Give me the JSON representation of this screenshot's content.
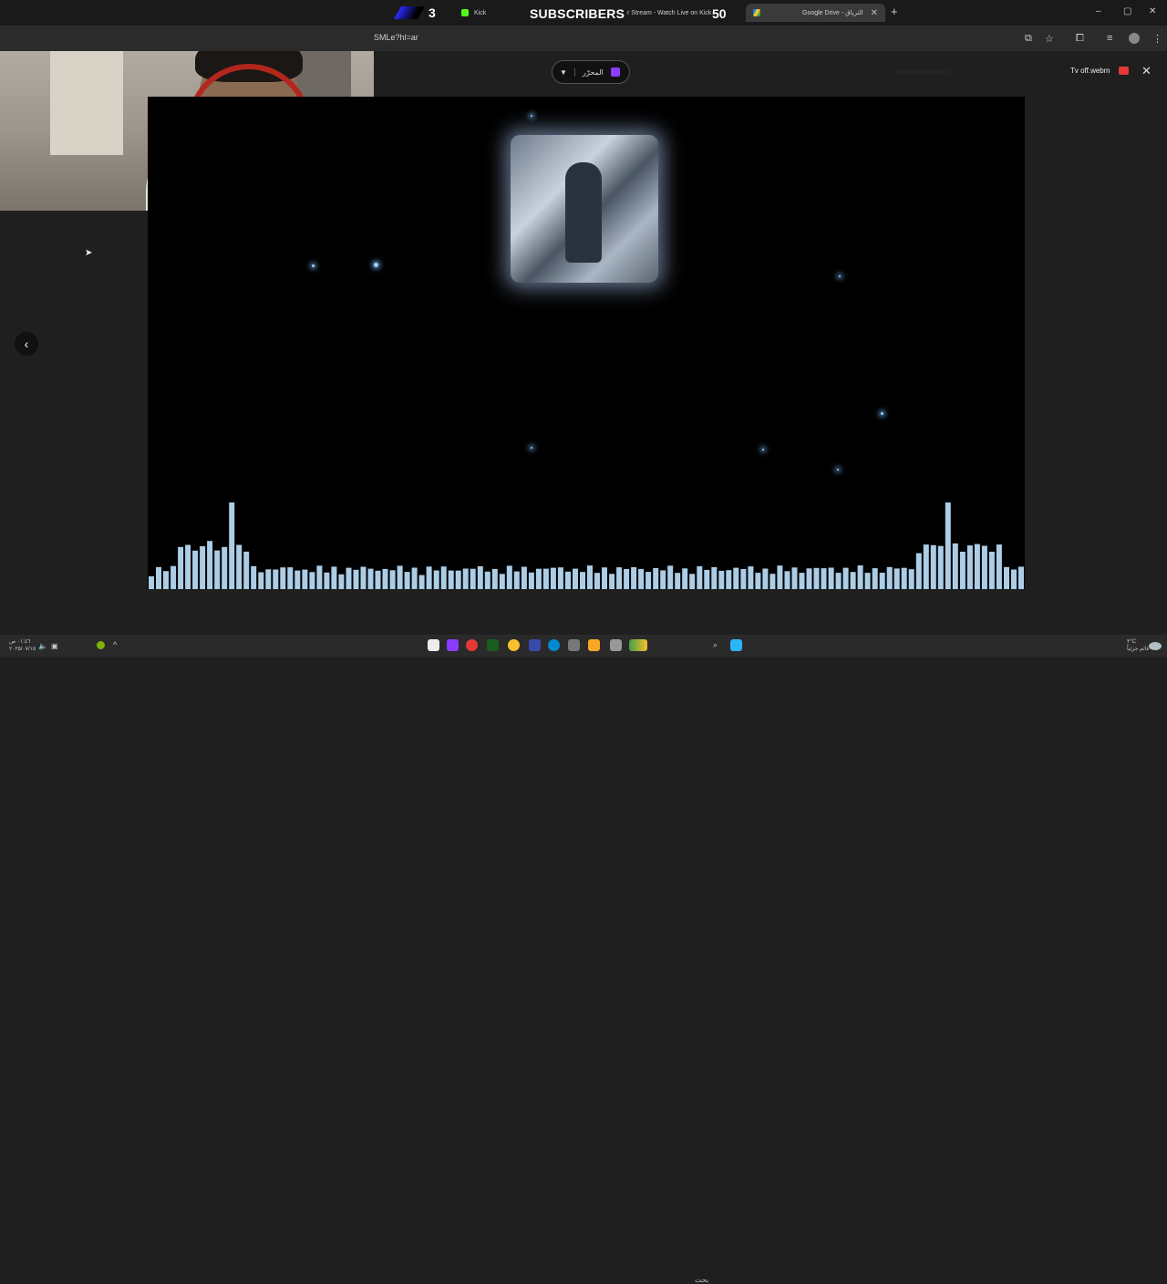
{
  "browser": {
    "tabs": [
      {
        "label": "Kick",
        "active": false
      },
      {
        "label": "r Stream - Watch Live on Kick",
        "active": false
      },
      {
        "label": "Google Drive - الترياق",
        "active": true
      }
    ],
    "new_tab_label": "+",
    "url": "SMLe?hl=ar",
    "window_controls": [
      "–",
      "▢",
      "✕"
    ]
  },
  "stream_overlay": {
    "left_count": "3",
    "title": "SUBSCRIBERS",
    "right_count": "50"
  },
  "drive_viewer": {
    "open_with_label": "المحرّر",
    "file_name": "Tv off.webm",
    "close_label": "✕",
    "back_label": "‹"
  },
  "video": {
    "description_colors": {
      "background": "#000000",
      "glow": "#9fd0ff"
    }
  },
  "taskbar": {
    "search_label": "بحث",
    "time": "٠١:٤٦ ص",
    "date": "٢٠٢٥/٠٧/١٥",
    "weather_temp": "٣°C",
    "weather_label": "غائم جزئياً"
  },
  "colors": {
    "accent_blue": "#2b2bff",
    "kick_green": "#53fc18",
    "file_red": "#e53935",
    "headset_red": "#b3261e"
  }
}
